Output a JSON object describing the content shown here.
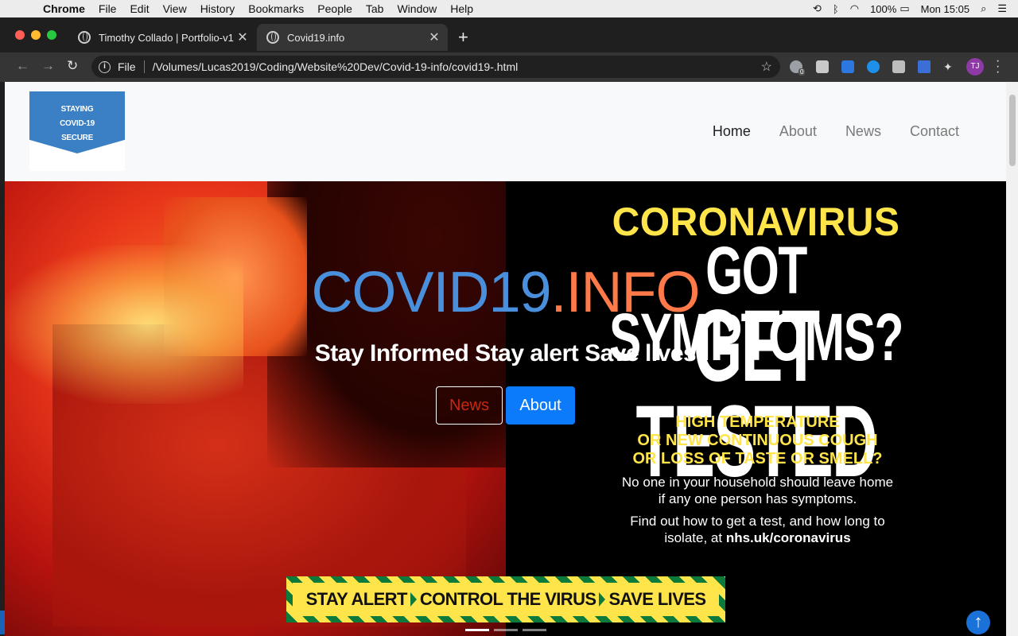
{
  "menubar": {
    "app": "Chrome",
    "items": [
      "File",
      "Edit",
      "View",
      "History",
      "Bookmarks",
      "People",
      "Tab",
      "Window",
      "Help"
    ],
    "battery": "100%",
    "clock": "Mon 15:05"
  },
  "tabs": [
    {
      "title": "Timothy Collado | Portfolio-v1"
    },
    {
      "title": "Covid19.info"
    }
  ],
  "toolbar": {
    "scheme_label": "File",
    "url": "/Volumes/Lucas2019/Coding/Website%20Dev/Covid-19-info/covid19-.html",
    "badge_count": "0",
    "profile_initials": "TJ"
  },
  "site": {
    "logo_lines": [
      "STAYING",
      "COVID-19",
      "SECURE"
    ],
    "nav": [
      "Home",
      "About",
      "News",
      "Contact"
    ],
    "hero": {
      "title_part1": "COVID19",
      "title_part2": ".INFO",
      "subtitle": "Stay Informed Stay alert Save lives",
      "news_button": "News",
      "about_button": "About"
    },
    "poster": {
      "line1": "CORONAVIRUS",
      "line2": "GOT SYMPTOMS?",
      "line3": "GET TESTED",
      "warn1": "HIGH TEMPERATURE",
      "warn2": "OR NEW CONTINUOUS COUGH",
      "warn3": "OR LOSS OF TASTE OR SMELL?",
      "body1": "No one in your household should leave home",
      "body2": "if any one person has symptoms.",
      "body3": "Find out how to get a test, and how long to",
      "body4_prefix": "isolate, at",
      "body4_link": "nhs.uk/coronavirus",
      "banner1": "STAY ALERT",
      "banner2": "CONTROL THE VIRUS",
      "banner3": "SAVE LIVES"
    },
    "carousel_active_index": 0,
    "carousel_count": 3
  },
  "colors": {
    "title_blue": "#4a8fdb",
    "title_orange": "#ff7a48",
    "poster_yellow": "#ffe44a",
    "button_blue": "#0b7bfb"
  }
}
